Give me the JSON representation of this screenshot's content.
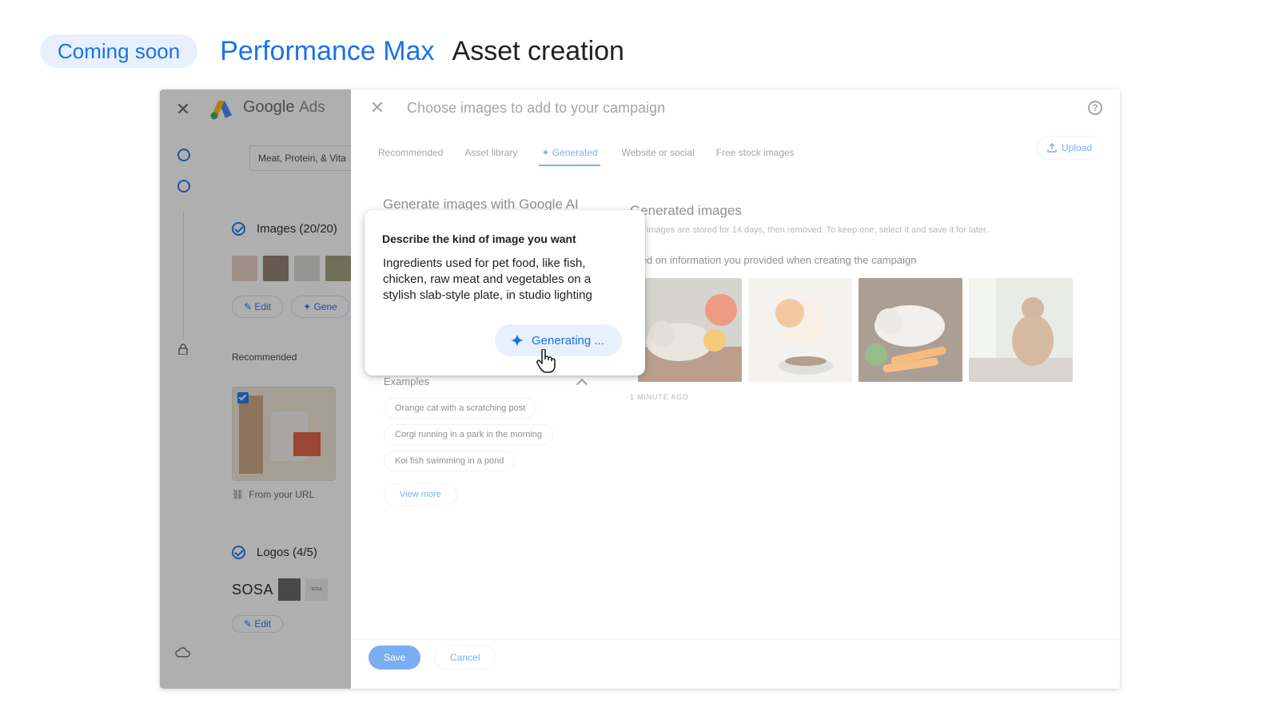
{
  "header": {
    "badge": "Coming soon",
    "title_blue": "Performance Max",
    "title_dark": "Asset creation"
  },
  "left_pane": {
    "brand_google": "Google",
    "brand_ads": "Ads",
    "business_chip": "Meat, Protein, & Vita",
    "images_section": "Images (20/20)",
    "edit_label": "Edit",
    "generate_label": "Gene",
    "recommended_label": "Recommended",
    "from_url": "From your URL",
    "logos_section": "Logos (4/5)",
    "logo_text": "SOSA",
    "logo_small_text": "SOSA",
    "logos_edit_label": "Edit"
  },
  "dialog": {
    "title": "Choose images to add to your campaign",
    "tabs": [
      {
        "label": "Recommended"
      },
      {
        "label": "Asset library"
      },
      {
        "label": "✦ Generated"
      },
      {
        "label": "Website or social"
      },
      {
        "label": "Free stock images"
      }
    ],
    "active_tab": 2,
    "upload_label": "Upload",
    "hidden_heading": "Generate images with Google AI",
    "generated_heading": "Generated images",
    "generated_sub": "ese images are stored for 14 days, then removed. To keep one, select it and save it for later.",
    "based_on": "ased on information you provided when creating the campaign",
    "time_ago": "1 MINUTE AGO",
    "examples_label": "Examples",
    "examples": [
      {
        "text": "Orange cat with a scratching post"
      },
      {
        "text": "Corgi running in a park in the morning"
      },
      {
        "text": "Koi fish swimming in a pond"
      }
    ],
    "view_more": "View more",
    "save": "Save",
    "cancel": "Cancel"
  },
  "prompt_card": {
    "label": "Describe the kind of image you want",
    "text": "Ingredients used for pet food, like fish, chicken, raw meat and vegetables on a stylish slab-style plate, in studio lighting",
    "button": "Generating ..."
  },
  "colors": {
    "accent": "#1a73e8",
    "accent_light": "#e8f0fe",
    "text_dark": "#202124",
    "text_muted": "#5f6368"
  }
}
